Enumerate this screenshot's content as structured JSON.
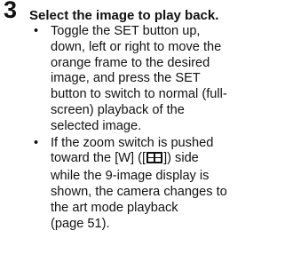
{
  "step": {
    "number": "3",
    "title": "Select the image to play back."
  },
  "bullets": [
    {
      "marker": "•",
      "lines": [
        "Toggle the SET button up,",
        "down, left or right to move the",
        "orange frame to the desired",
        "image, and press the SET",
        "button to switch to normal (full-",
        "screen) playback of the",
        "selected image."
      ]
    },
    {
      "marker": "•",
      "lines": [
        "If the zoom switch is pushed",
        "toward the [W] ([",
        "]) side",
        "while the 9-image display is",
        "shown, the camera changes to",
        "the art mode playback",
        "(page 51)."
      ],
      "icon": "art-mode-grid-icon"
    }
  ]
}
